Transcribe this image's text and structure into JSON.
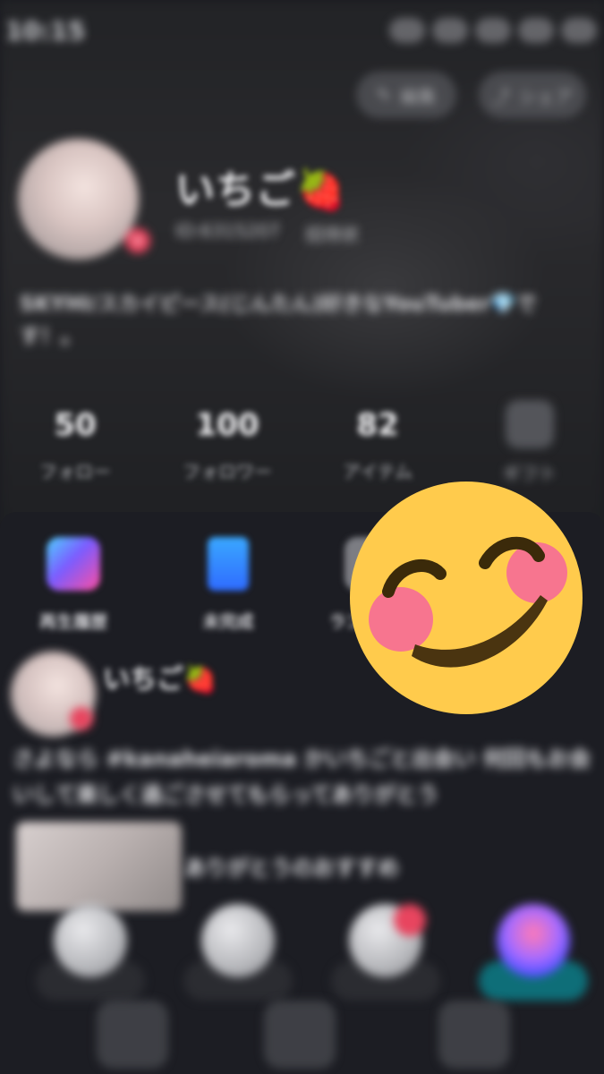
{
  "status_bar": {
    "time": "10:15"
  },
  "top_buttons": {
    "edit_label": "編集",
    "share_label": "シェア"
  },
  "profile": {
    "name": "いちご🍓",
    "id_label": "ID:6315207",
    "status": "招待状",
    "bio": "SKYHI/スカイピース(じんたん)好きなYouTuber💎です！。"
  },
  "stats": [
    {
      "value": "50",
      "label": "フォロー"
    },
    {
      "value": "100",
      "label": "フォロワー"
    },
    {
      "value": "82",
      "label": "アイテム"
    },
    {
      "value": "",
      "label": "ギフト"
    }
  ],
  "shortcuts": [
    {
      "label": "再生履歴",
      "icon": "music-note-icon"
    },
    {
      "label": "未完成",
      "icon": "document-icon"
    },
    {
      "label": "ランキング",
      "icon": "ranking-icon"
    }
  ],
  "post": {
    "author": "いちご🍓",
    "subtitle": "",
    "text": "さよなら #kanaheiaroma かいちごと出会い 何回もお会いして楽しく過ごさせてもらってありがとう",
    "tag": "ありがとうのおすすめ"
  },
  "emoji": {
    "name": "smiling-face-with-smiling-eyes"
  }
}
